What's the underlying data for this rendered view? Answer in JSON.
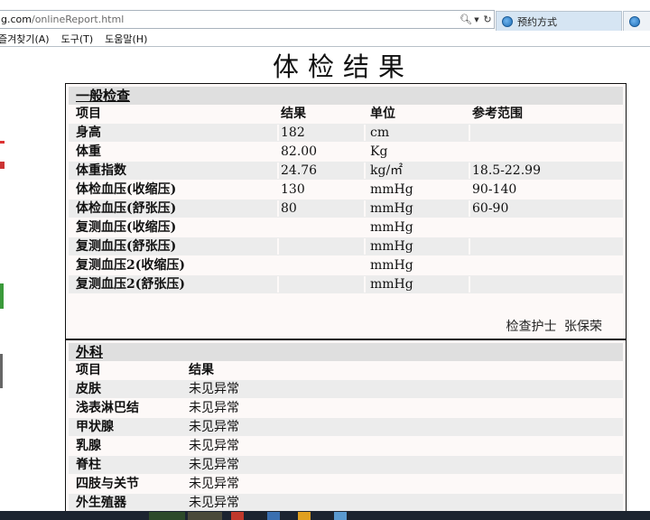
{
  "browser": {
    "address_host": "g.com",
    "address_path": "/onlineReport.html",
    "search_icon": "search-icon",
    "dropdown_icon": "chevron-down-icon",
    "refresh_icon": "refresh-icon",
    "tabs": [
      {
        "label": "预约方式"
      },
      {
        "label": ""
      }
    ],
    "menu": [
      "즐겨찾기(A)",
      "도구(T)",
      "도움말(H)"
    ]
  },
  "report": {
    "title": "体检结果",
    "general": {
      "heading": "一般检查",
      "columns": [
        "项目",
        "结果",
        "单位",
        "参考范围"
      ],
      "rows": [
        {
          "item": "身高",
          "result": "182",
          "unit": "cm",
          "range": ""
        },
        {
          "item": "体重",
          "result": "82.00",
          "unit": "Kg",
          "range": ""
        },
        {
          "item": "体重指数",
          "result": "24.76",
          "unit": "kg/㎡",
          "range": "18.5-22.99"
        },
        {
          "item": "体检血压(收缩压)",
          "result": "130",
          "unit": "mmHg",
          "range": "90-140"
        },
        {
          "item": "体检血压(舒张压)",
          "result": "80",
          "unit": "mmHg",
          "range": "60-90"
        },
        {
          "item": "复测血压(收缩压)",
          "result": "",
          "unit": "mmHg",
          "range": ""
        },
        {
          "item": "复测血压(舒张压)",
          "result": "",
          "unit": "mmHg",
          "range": ""
        },
        {
          "item": "复测血压2(收缩压)",
          "result": "",
          "unit": "mmHg",
          "range": ""
        },
        {
          "item": "复测血压2(舒张压)",
          "result": "",
          "unit": "mmHg",
          "range": ""
        }
      ],
      "nurse_label": "检查护士",
      "nurse_name": "张保荣"
    },
    "surgery": {
      "heading": "外科",
      "columns": [
        "项目",
        "结果"
      ],
      "rows": [
        {
          "item": "皮肤",
          "result": "未见异常"
        },
        {
          "item": "浅表淋巴结",
          "result": "未见异常"
        },
        {
          "item": "甲状腺",
          "result": "未见异常"
        },
        {
          "item": "乳腺",
          "result": "未见异常"
        },
        {
          "item": "脊柱",
          "result": "未见异常"
        },
        {
          "item": "四肢与关节",
          "result": "未见异常"
        },
        {
          "item": "外生殖器",
          "result": "未见异常"
        }
      ]
    }
  },
  "colors": {
    "section_bg": "#fdf9f8",
    "header_bg": "#dfdfdf",
    "row_shade": "#ececec",
    "tab_active": "#d6e5f3"
  }
}
